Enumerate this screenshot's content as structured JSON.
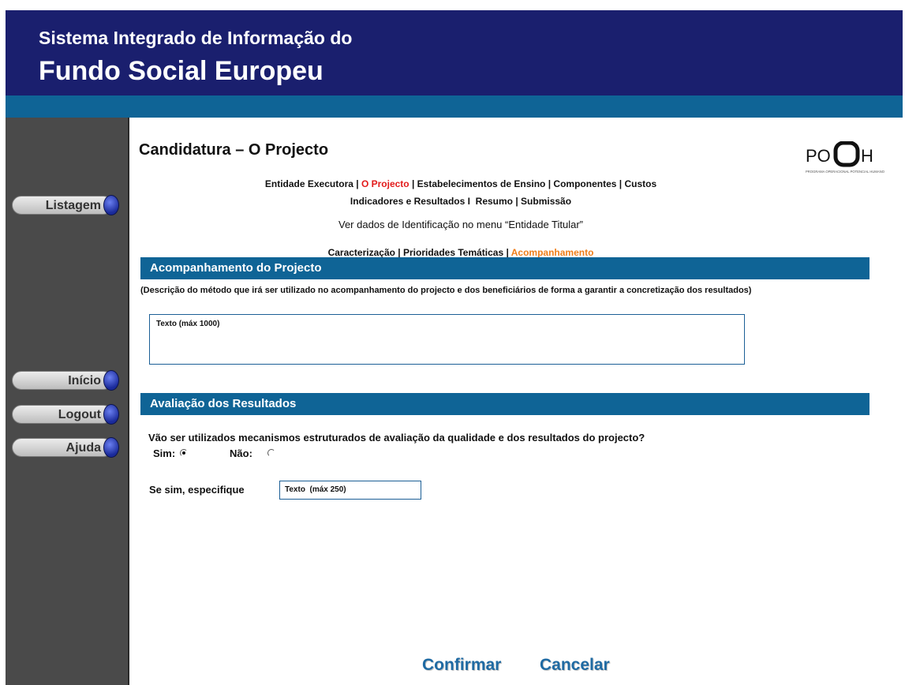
{
  "header": {
    "line1": "Sistema Integrado de Informação do",
    "line2": "Fundo Social Europeu"
  },
  "sidebar": {
    "items": [
      {
        "label": "Listagem"
      },
      {
        "label": "Início"
      },
      {
        "label": "Logout"
      },
      {
        "label": "Ajuda"
      }
    ]
  },
  "page": {
    "title": "Candidatura – O Projecto",
    "logo_text": "POPH",
    "logo_subtext": "PROGRAMA OPERACIONAL POTENCIAL HUMANO"
  },
  "main_nav": {
    "line1": [
      {
        "label": "Entidade Executora",
        "state": "normal"
      },
      {
        "sep": " | "
      },
      {
        "label": "O Projecto",
        "state": "active"
      },
      {
        "sep": " | "
      },
      {
        "label": "Estabelecimentos de Ensino",
        "state": "normal"
      },
      {
        "sep": " | "
      },
      {
        "label": "Componentes",
        "state": "normal"
      },
      {
        "sep": " | "
      },
      {
        "label": "Custos",
        "state": "normal"
      }
    ],
    "line2": [
      {
        "label": "Indicadores e Resultados",
        "state": "normal"
      },
      {
        "sep": " I  "
      },
      {
        "label": "Resumo",
        "state": "normal"
      },
      {
        "sep": " | "
      },
      {
        "label": "Submissão",
        "state": "normal"
      }
    ]
  },
  "info_text": "Ver dados de Identificação no menu “Entidade Titular”",
  "sub_nav": [
    {
      "label": "Caracterização",
      "state": "normal"
    },
    {
      "sep": " | "
    },
    {
      "label": "Prioridades Temáticas",
      "state": "normal"
    },
    {
      "sep": " | "
    },
    {
      "label": "Acompanhamento",
      "state": "current"
    }
  ],
  "section_acompanhamento": {
    "title": "Acompanhamento do Projecto",
    "description": "(Descrição do método que irá ser utilizado no acompanhamento do projecto e dos beneficiários de forma a garantir a concretização dos resultados)",
    "textarea_placeholder": "Texto (máx 1000)"
  },
  "section_avaliacao": {
    "title": "Avaliação dos Resultados",
    "question": "Vão ser utilizados mecanismos estruturados de avaliação da qualidade e dos resultados do projecto?",
    "options": [
      {
        "label": "Sim:",
        "selected": true
      },
      {
        "label": "Não:",
        "selected": false
      }
    ],
    "specify_label": "Se sim, especifique",
    "specify_placeholder": "Texto  (máx 250)"
  },
  "actions": {
    "confirm": "Confirmar",
    "cancel": "Cancelar"
  },
  "colors": {
    "header_bg": "#1a1f6e",
    "bar_bg": "#0f6496",
    "sidebar_bg": "#4a4a4a",
    "active_link": "#e21b1b",
    "current_subtab": "#f07e1a",
    "action_text": "#1f6aa3"
  }
}
